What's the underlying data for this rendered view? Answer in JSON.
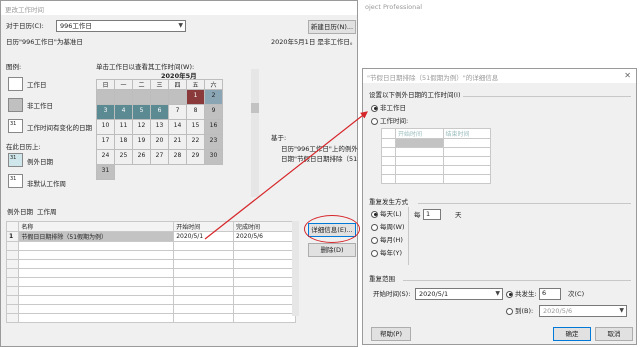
{
  "left_dialog": {
    "title": "更改工作时间",
    "for_calendar_label": "对于日历(C):",
    "calendar_value": "996工作日",
    "new_calendar_button": "新建日历(N)...",
    "base_calendar_text": "日历\"996工作日\"为基准日",
    "legend_title": "图例:",
    "legend": [
      {
        "label": "工作日"
      },
      {
        "label": "非工作日"
      },
      {
        "label": "工作时间有变化的日期",
        "sample": "31"
      }
    ],
    "on_this_calendar": "在此日历上:",
    "legend2": [
      {
        "label": "例外日期",
        "sample": "31"
      },
      {
        "label": "非默认工作周",
        "sample": "31"
      }
    ],
    "click_hint": "单击工作日以查看其工作时间(W):",
    "month_title": "2020年5月",
    "weekdays": [
      "日",
      "一",
      "二",
      "三",
      "四",
      "五",
      "六"
    ],
    "weeks": [
      [
        "",
        "",
        "",
        "",
        "",
        "1",
        "2"
      ],
      [
        "3",
        "4",
        "5",
        "6",
        "7",
        "8",
        "9"
      ],
      [
        "10",
        "11",
        "12",
        "13",
        "14",
        "15",
        "16"
      ],
      [
        "17",
        "18",
        "19",
        "20",
        "21",
        "22",
        "23"
      ],
      [
        "24",
        "25",
        "26",
        "27",
        "28",
        "29",
        "30"
      ],
      [
        "31",
        "",
        "",
        "",
        "",
        "",
        ""
      ]
    ],
    "date_note": "2020年5月1日 是非工作日。",
    "based_on": "基于:",
    "based_detail_1": "日历\"996工作日\"上的例外",
    "based_detail_2": "日期\"节假日日期排除（51",
    "tabs": [
      "例外日期",
      "工作周"
    ],
    "exceptions_headers": [
      "",
      "名称",
      "开始时间",
      "完成时间"
    ],
    "exceptions_rows": [
      {
        "num": "1",
        "name": "节假日日期排除（51假期为例）",
        "start": "2020/5/1",
        "finish": "2020/5/6"
      }
    ],
    "details_button": "详细信息(E)...",
    "delete_button": "删除(D)"
  },
  "bg_title": "oject Professional",
  "right_dialog": {
    "title": "\"节假日日期排除（51假期为例）\"的详细信息",
    "set_label": "设置以下例外日期的工作时间(I)",
    "nonworking": "非工作日",
    "working_time": "工作时间:",
    "time_headers": [
      "开始时间",
      "结束时间"
    ],
    "recurrence_title": "重复发生方式",
    "recurrence_options": [
      "每天(L)",
      "每周(W)",
      "每月(H)",
      "每年(Y)"
    ],
    "every_label": "每",
    "every_value": "1",
    "every_unit": "天",
    "range_title": "重复范围",
    "start_label": "开始时间(S):",
    "start_value": "2020/5/1",
    "occurrences_label": "共发生:",
    "occurrences_value": "6",
    "occurrences_unit": "次(C)",
    "to_label": "到(B):",
    "to_value": "2020/5/6",
    "help_button": "帮助(P)",
    "ok_button": "确定",
    "cancel_button": "取消"
  }
}
